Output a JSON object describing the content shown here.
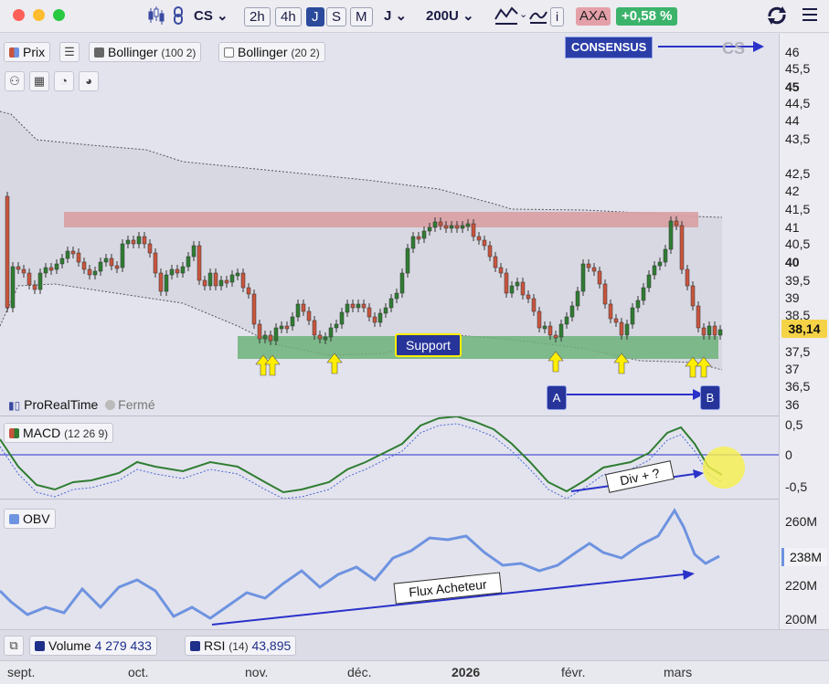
{
  "toolbar": {
    "symbol": "CS",
    "period_2h": "2h",
    "period_4h": "4h",
    "period_j": "J",
    "period_s": "S",
    "period_m": "M",
    "period_dropdown": "J",
    "units_dropdown": "200U",
    "info": "i",
    "ticker": "AXA",
    "change": "+0,58 %"
  },
  "price_panel": {
    "legend_prix": "Prix",
    "legend_bollinger_a": "Bollinger",
    "legend_bollinger_a_params": "(100 2)",
    "legend_bollinger_b": "Bollinger",
    "legend_bollinger_b_params": "(20 2)",
    "consensus_label": "CONSENSUS",
    "watermark": "CS",
    "support_label": "Support",
    "point_a": "A",
    "point_b": "B",
    "brand": "ProRealTime",
    "market_status": "Fermé",
    "current_price": "38,14",
    "y_labels": [
      "46",
      "45,5",
      "45",
      "44,5",
      "44",
      "43,5",
      "42,5",
      "42",
      "41,5",
      "41",
      "40,5",
      "40",
      "39,5",
      "39",
      "38,5",
      "37,5",
      "37",
      "36,5",
      "36"
    ]
  },
  "macd_panel": {
    "legend": "MACD",
    "params": "(12 26 9)",
    "annotation": "Div + ?",
    "y_labels": [
      "0,5",
      "0",
      "-0,5"
    ]
  },
  "obv_panel": {
    "legend": "OBV",
    "annotation": "Flux  Acheteur",
    "current_value": "238M",
    "y_labels": [
      "260M",
      "220M",
      "200M"
    ]
  },
  "bottom_bar": {
    "volume_label": "Volume",
    "volume_value": "4 279 433",
    "rsi_label": "RSI",
    "rsi_params": "(14)",
    "rsi_value": "43,895"
  },
  "x_axis": {
    "labels": [
      "sept.",
      "oct.",
      "nov.",
      "déc.",
      "2026",
      "févr.",
      "mars"
    ]
  },
  "colors": {
    "up_candle": "#2f7d32",
    "down_candle": "#c8553d",
    "resistance_zone": "#d9a0a3",
    "support_zone": "#6db37a",
    "arrow_yellow": "#ffee00",
    "annotation_blue": "#2a32c9",
    "obv_line": "#6e93e0"
  }
}
